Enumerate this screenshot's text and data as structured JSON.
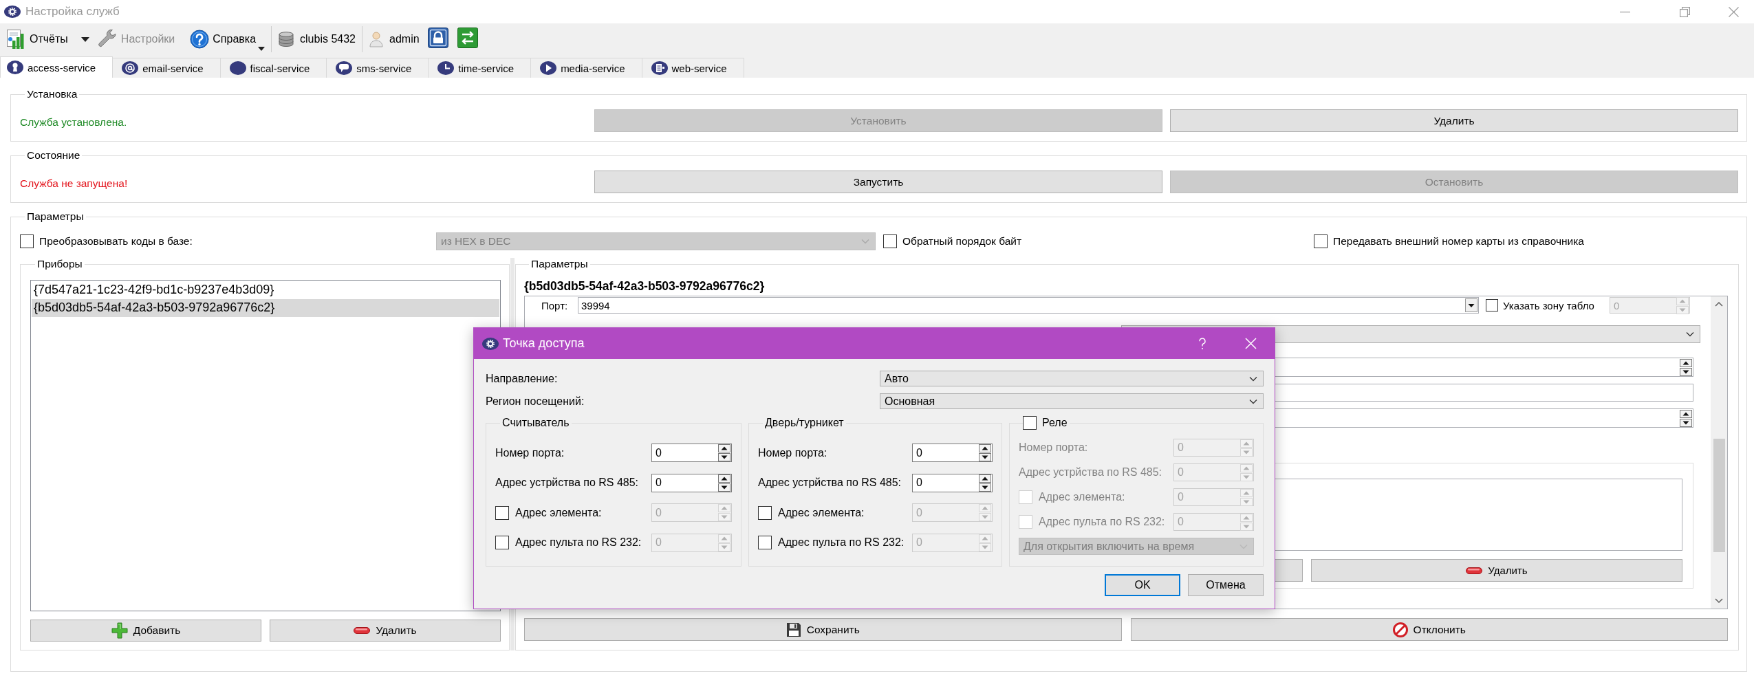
{
  "window": {
    "title": "Настройка служб"
  },
  "toolbar": {
    "items": [
      {
        "kind": "split-menu",
        "label": "Отчёты",
        "disabled": false
      },
      {
        "kind": "button",
        "label": "Настройки",
        "disabled": true
      },
      {
        "kind": "menu",
        "label": "Справка",
        "disabled": false
      },
      {
        "kind": "info",
        "label": "clubis 5432",
        "disabled": false
      },
      {
        "kind": "info",
        "label": "admin",
        "disabled": false
      }
    ]
  },
  "tabs": [
    {
      "label": "access-service",
      "selected": true
    },
    {
      "label": "email-service",
      "selected": false
    },
    {
      "label": "fiscal-service",
      "selected": false
    },
    {
      "label": "sms-service",
      "selected": false
    },
    {
      "label": "time-service",
      "selected": false
    },
    {
      "label": "media-service",
      "selected": false
    },
    {
      "label": "web-service",
      "selected": false
    }
  ],
  "install": {
    "title": "Установка",
    "status": "Служба установлена.",
    "ok": true,
    "buttons": [
      {
        "label": "Установить",
        "disabled": true
      },
      {
        "label": "Удалить",
        "disabled": false
      }
    ]
  },
  "state": {
    "title": "Состояние",
    "status": "Служба не запущена!",
    "ok": false,
    "buttons": [
      {
        "label": "Запустить",
        "disabled": false
      },
      {
        "label": "Остановить",
        "disabled": true
      }
    ]
  },
  "parameters": {
    "title": "Параметры",
    "options": [
      {
        "kind": "check-select",
        "label": "Преобразовывать коды в базе:",
        "checked": false,
        "value": "из HEX в DEC"
      },
      {
        "kind": "check",
        "label": "Обратный порядок байт",
        "checked": false
      },
      {
        "kind": "check",
        "label": "Передавать внешний номер карты из справочника",
        "checked": false
      }
    ],
    "devices": {
      "title": "Приборы",
      "items": [
        {
          "label": "{7d547a21-1c23-42f9-bd1c-b9237e4b3d09}",
          "selected": false
        },
        {
          "label": "{b5d03db5-54af-42a3-b503-9792a96776c2}",
          "selected": true
        }
      ],
      "buttons": [
        {
          "kind": "add",
          "label": "Добавить"
        },
        {
          "kind": "remove",
          "label": "Удалить"
        }
      ]
    },
    "device_params": {
      "title": "Параметры",
      "heading": "{b5d03db5-54af-42a3-b503-9792a96776c2}",
      "port": {
        "label": "Порт:",
        "value": "39994"
      },
      "zone": {
        "label": "Указать зону табло",
        "checked": false,
        "value": "0"
      },
      "remove_button": {
        "label": "Удалить"
      }
    },
    "actions": [
      {
        "kind": "save",
        "label": "Сохранить"
      },
      {
        "kind": "reject",
        "label": "Отклонить"
      }
    ]
  },
  "dialog": {
    "title": "Точка доступа",
    "fields": [
      {
        "label": "Направление:",
        "value": "Авто"
      },
      {
        "label": "Регион посещений:",
        "value": "Основная"
      }
    ],
    "groups": [
      {
        "kind": "plain",
        "title": "Считыватель",
        "rows": [
          {
            "kind": "spin",
            "label": "Номер порта:",
            "value": "0"
          },
          {
            "kind": "spin",
            "label": "Адрес устрйства по RS 485:",
            "value": "0"
          },
          {
            "kind": "check-spin",
            "label": "Адрес элемента:",
            "checked": false,
            "value": "0"
          },
          {
            "kind": "check-spin",
            "label": "Адрес пульта по RS 232:",
            "checked": false,
            "value": "0"
          }
        ]
      },
      {
        "kind": "plain",
        "title": "Дверь/турникет",
        "rows": [
          {
            "kind": "spin",
            "label": "Номер порта:",
            "value": "0"
          },
          {
            "kind": "spin",
            "label": "Адрес устрйства по RS 485:",
            "value": "0"
          },
          {
            "kind": "check-spin",
            "label": "Адрес элемента:",
            "checked": false,
            "value": "0"
          },
          {
            "kind": "check-spin",
            "label": "Адрес пульта по RS 232:",
            "checked": false,
            "value": "0"
          }
        ]
      },
      {
        "kind": "checkable",
        "title": "Реле",
        "checked": false,
        "rows": [
          {
            "kind": "spin",
            "label": "Номер порта:",
            "value": "0"
          },
          {
            "kind": "spin",
            "label": "Адрес устрйства по RS 485:",
            "value": "0"
          },
          {
            "kind": "check-spin",
            "label": "Адрес элемента:",
            "checked": false,
            "value": "0"
          },
          {
            "kind": "check-spin",
            "label": "Адрес пульта по RS 232:",
            "checked": false,
            "value": "0"
          },
          {
            "kind": "select",
            "value": "Для открытия включить на время"
          }
        ]
      }
    ],
    "buttons": [
      {
        "label": "OK",
        "focused": true
      },
      {
        "label": "Отмена",
        "focused": false
      }
    ]
  }
}
